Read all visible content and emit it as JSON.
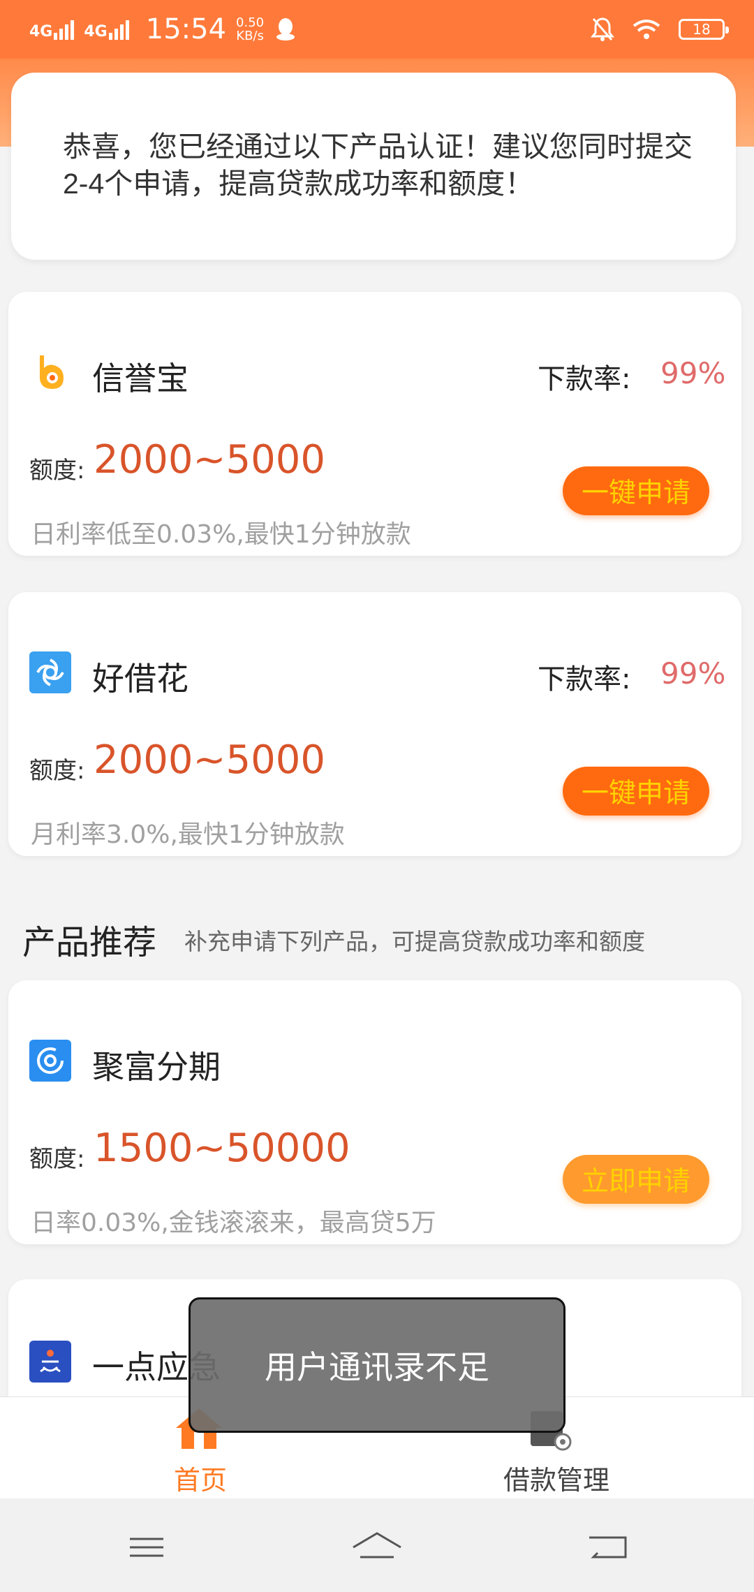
{
  "status_bar": {
    "network_1": "4G",
    "network_2": "4G",
    "time": "15:54",
    "speed_value": "0.50",
    "speed_unit": "KB/s",
    "battery": "18"
  },
  "notice": {
    "text": "恭喜，您已经通过以下产品认证！建议您同时提交2-4个申请，提高贷款成功率和额度！"
  },
  "certified_products": [
    {
      "name": "信誉宝",
      "rate_label": "下款率:",
      "rate_value": "99%",
      "quota_label": "额度:",
      "quota_value": "2000~5000",
      "description": "日利率低至0.03%,最快1分钟放款",
      "button_label": "一键申请",
      "icon": "xinyubao-logo-icon"
    },
    {
      "name": "好借花",
      "rate_label": "下款率:",
      "rate_value": "99%",
      "quota_label": "额度:",
      "quota_value": "2000~5000",
      "description": "月利率3.0%,最快1分钟放款",
      "button_label": "一键申请",
      "icon": "haojiehua-logo-icon"
    }
  ],
  "recommend_section": {
    "title": "产品推荐",
    "subtitle": "补充申请下列产品，可提高贷款成功率和额度"
  },
  "recommended_products": [
    {
      "name": "聚富分期",
      "quota_label": "额度:",
      "quota_value": "1500~50000",
      "description": "日率0.03%,金钱滚滚来，最高贷5万",
      "button_label": "立即申请",
      "icon": "jufu-logo-icon"
    },
    {
      "name": "一点应急",
      "icon": "yidian-logo-icon"
    }
  ],
  "toast": {
    "message": "用户通讯录不足"
  },
  "tab_bar": {
    "home_label": "首页",
    "loan_label": "借款管理"
  },
  "colors": {
    "brand_orange": "#ff7a3a",
    "button_orange": "#ff6a10",
    "button_yellow_text": "#ffd200",
    "quota_red": "#d9542a",
    "rate_pink": "#e06a6a"
  }
}
